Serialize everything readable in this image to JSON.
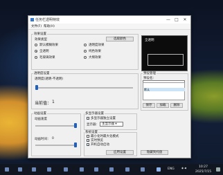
{
  "window": {
    "title": "任务栏透明特效",
    "minimize_glyph": "—",
    "maximize_glyph": "□",
    "close_glyph": "✕"
  },
  "menu": [
    "文件(F)",
    "帮助(H)"
  ],
  "effect_settings": {
    "group_label": "效果设置",
    "type_label": "效果类型",
    "options": [
      "默认模糊效果",
      "透明度效果",
      "全透明",
      "纯色效果",
      "毛玻璃效果",
      "大纲效果"
    ],
    "selected": "全透明",
    "choose_color_button": "选取颜色"
  },
  "preview": {
    "label": "全透明"
  },
  "transparency": {
    "group_label": "透明度设置",
    "slider_label": "透明度(透明-不透明)",
    "current_value_label": "当前值：",
    "current_value": "1",
    "slider_level": 0.01
  },
  "preset_manager": {
    "group_label": "预设管理",
    "name_label": "预设名：",
    "list_items": [
      "默认"
    ],
    "save_button": "保存",
    "load_button": "加载",
    "delete_button": "删除"
  },
  "animation": {
    "group_label": "动画设置",
    "speed_label": "动画速度",
    "speed_level": 0.95,
    "time_label": "动画时间：",
    "time_value": "0",
    "time_level": 0.95
  },
  "multi_monitor": {
    "group_label": "多显示器设置",
    "checkbox_label": "多显示器独立设置",
    "checked": true,
    "monitor_label": "显示器：",
    "monitor_value": "主显示器"
  },
  "system": {
    "group_label": "系统设置",
    "options": [
      {
        "label": "最小化时最大化模式",
        "checked": false
      },
      {
        "label": "实时预览",
        "checked": true
      },
      {
        "label": "开机自动启动",
        "checked": true
      }
    ],
    "apply_button": "应用设置",
    "hide_button": "隐藏到托盘"
  },
  "taskbar": {
    "lang": "ENG",
    "time": "10:27",
    "date": "2025/7/15"
  }
}
